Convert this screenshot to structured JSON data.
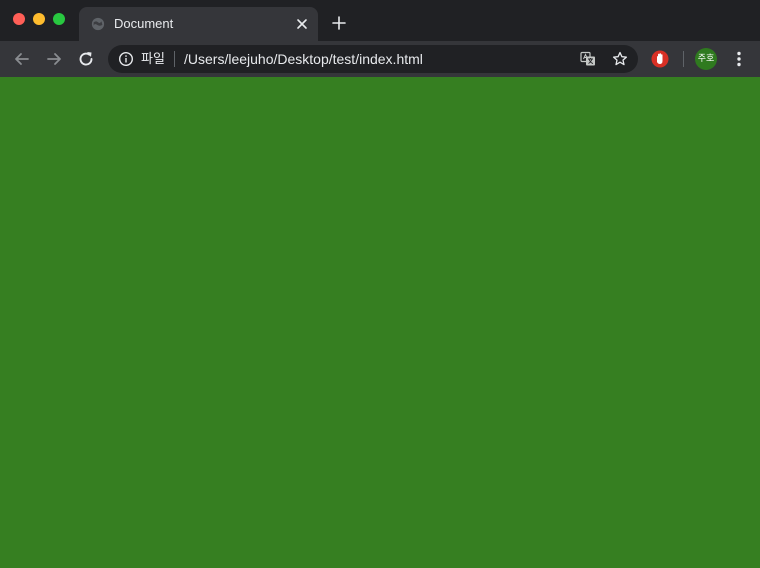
{
  "tab": {
    "title": "Document",
    "favicon": "globe-icon",
    "close_icon": "close-icon"
  },
  "toolbar": {
    "back_icon": "arrow-left-icon",
    "forward_icon": "arrow-right-icon",
    "reload_icon": "reload-icon",
    "new_tab_icon": "plus-icon",
    "translate_icon": "translate-icon",
    "bookmark_icon": "star-icon",
    "extension_icon": "hand-stop-icon",
    "menu_icon": "kebab-menu-icon"
  },
  "omnibox": {
    "info_icon": "info-icon",
    "scheme_label": "파일",
    "url": "/Users/leejuho/Desktop/test/index.html"
  },
  "profile": {
    "avatar_text": "주호",
    "avatar_color": "#2f7a1f"
  },
  "page": {
    "background_color": "#367f21"
  },
  "colors": {
    "tabstrip": "#202124",
    "toolbar": "#35363a",
    "omnibox": "#202124",
    "text": "#e8eaed",
    "traffic_red": "#ff5f57",
    "traffic_yellow": "#febc2e",
    "traffic_green": "#28c840"
  }
}
